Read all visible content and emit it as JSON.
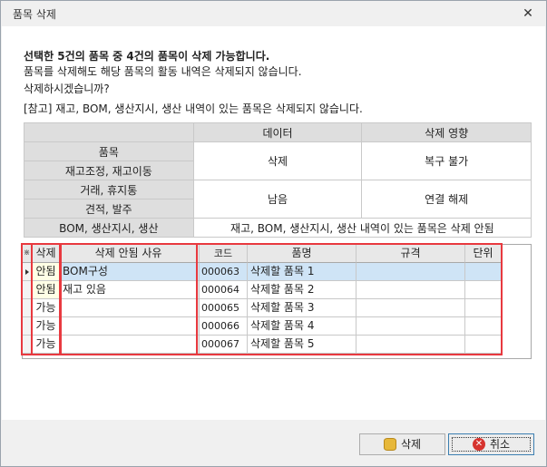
{
  "window": {
    "title": "품목 삭제",
    "close_glyph": "✕"
  },
  "message": {
    "headline": "선택한 5건의 품목 중 4건의 품목이 삭제 가능합니다.",
    "line1": "품목를 삭제해도 해당 품목의 활동 내역은 삭제되지 않습니다.",
    "line2": "삭제하시겠습니까?",
    "note": "[참고] 재고, BOM, 생산지시, 생산 내역이 있는 품목은 삭제되지 않습니다."
  },
  "info_table": {
    "headers": [
      "",
      "데이터",
      "삭제 영향"
    ],
    "rows": [
      {
        "label": "품목",
        "data": "삭제",
        "impact": "복구 불가"
      },
      {
        "label": "재고조정, 재고이동"
      },
      {
        "label": "거래, 휴지통",
        "data": "남음",
        "impact": "연결 해제"
      },
      {
        "label": "견적, 발주"
      },
      {
        "label": "BOM, 생산지시, 생산",
        "merged": "재고, BOM, 생산지시, 생산 내역이 있는 품목은 삭제 안됨"
      }
    ]
  },
  "grid": {
    "indicator_glyph": "⋇",
    "columns": {
      "status": "삭제",
      "reason": "삭제 안됨 사유",
      "code": "코드",
      "name": "품명",
      "spec": "규격",
      "unit": "단위"
    },
    "rows": [
      {
        "status": "안됨",
        "reason": "BOM구성",
        "code": "000063",
        "name": "삭제할 품목 1",
        "spec": "",
        "unit": ""
      },
      {
        "status": "안됨",
        "reason": "재고 있음",
        "code": "000064",
        "name": "삭제할 품목 2",
        "spec": "",
        "unit": ""
      },
      {
        "status": "가능",
        "reason": "",
        "code": "000065",
        "name": "삭제할 품목 3",
        "spec": "",
        "unit": ""
      },
      {
        "status": "가능",
        "reason": "",
        "code": "000066",
        "name": "삭제할 품목 4",
        "spec": "",
        "unit": ""
      },
      {
        "status": "가능",
        "reason": "",
        "code": "000067",
        "name": "삭제할 품목 5",
        "spec": "",
        "unit": ""
      }
    ]
  },
  "buttons": {
    "delete": "삭제",
    "cancel": "취소"
  },
  "colors": {
    "highlight": "#e8393f",
    "selected_row": "#cfe4f6"
  }
}
